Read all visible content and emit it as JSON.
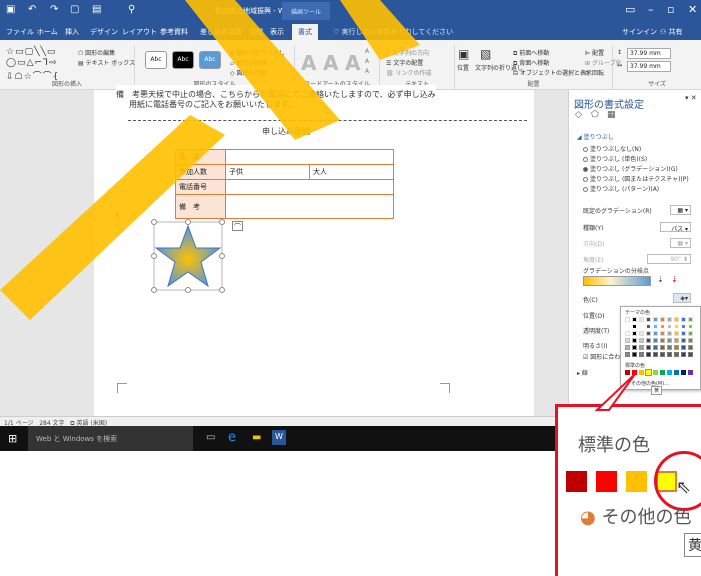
{
  "window": {
    "title": "飲食店と地域振興 - Word",
    "context_tab": "描画ツール",
    "user": "サインイン",
    "share": "共有"
  },
  "tabs": [
    "ファイル",
    "ホーム",
    "挿入",
    "デザイン",
    "レイアウト",
    "参考資料",
    "差し込み文書",
    "校閲",
    "表示",
    "書式"
  ],
  "tellme": "実行したい作業を入力してください",
  "ribbon": {
    "insert_shapes": {
      "label": "図形の挿入",
      "edit_shape": "図形の編集",
      "textbox": "テキスト ボックス"
    },
    "shape_styles": {
      "label": "図形のスタイル",
      "fill": "図形の塗りつぶし",
      "outline": "図形の枠線",
      "effects": "図形の効果",
      "sample": "Abc"
    },
    "wordart": {
      "label": "ワードアートのスタイル",
      "letter": "A"
    },
    "text": {
      "label": "テキスト",
      "direction": "文字列の方向",
      "align": "文字の配置",
      "link": "リンクの作成"
    },
    "arrange": {
      "label": "配置",
      "position": "位置",
      "wrap": "文字列の折り返し",
      "forward": "前面へ移動",
      "backward": "背面へ移動",
      "selection": "オブジェクトの選択と表示",
      "align": "配置",
      "group": "グループ化",
      "rotate": "回転"
    },
    "size": {
      "label": "サイズ",
      "height": "37.99 mm",
      "width": "37.99 mm"
    }
  },
  "document": {
    "line1": "備　考悪天候で中止の場合、こちらからお電話にてご連絡いたしますので、必ず申し込み",
    "line2": "用紙に電話番号のご記入をお願いいたします。",
    "form_title": "申し込み用紙",
    "form": {
      "name_label": "氏　名",
      "people_label": "参加人数",
      "child": "子供",
      "adult": "大人",
      "phone_label": "電話番号",
      "notes_label": "備　考"
    }
  },
  "pane": {
    "title": "図形の書式設定",
    "section": "塗りつぶし",
    "options": [
      "塗りつぶしなし(N)",
      "塗りつぶし (単色)(S)",
      "塗りつぶし (グラデーション)(G)",
      "塗りつぶし (図またはテクスチャ)(P)",
      "塗りつぶし (パターン)(A)"
    ],
    "selected_option": 2,
    "preset": "既定のグラデーション(R)",
    "type_label": "種類(Y)",
    "type_value": "パス",
    "direction_label": "方向(D)",
    "angle_label": "角度(E)",
    "angle_value": "90°",
    "stops_label": "グラデーションの分岐点",
    "color_label": "色(C)",
    "position_label": "位置(O)",
    "transparency_label": "透明度(T)",
    "brightness_label": "明るさ(I)",
    "rotate_label": "図形に合わせて回転する",
    "line_label": "線"
  },
  "palette": {
    "theme_label": "テーマの色",
    "standard_label": "標準の色",
    "more": "その他の色(M)...",
    "tooltip": "黄"
  },
  "status": {
    "page": "1/1 ページ",
    "words": "284 文字",
    "lang": "英語 (米国)"
  },
  "taskbar": {
    "search": "Web と Windows を検索"
  },
  "zoom": {
    "label": "標準の色",
    "more": "その他の色",
    "tooltip": "黄"
  },
  "colors": {
    "accent": "#2b579a",
    "watermark": "#ffc000",
    "callout": "#e81123",
    "selected_swatch": "#ffff00"
  }
}
